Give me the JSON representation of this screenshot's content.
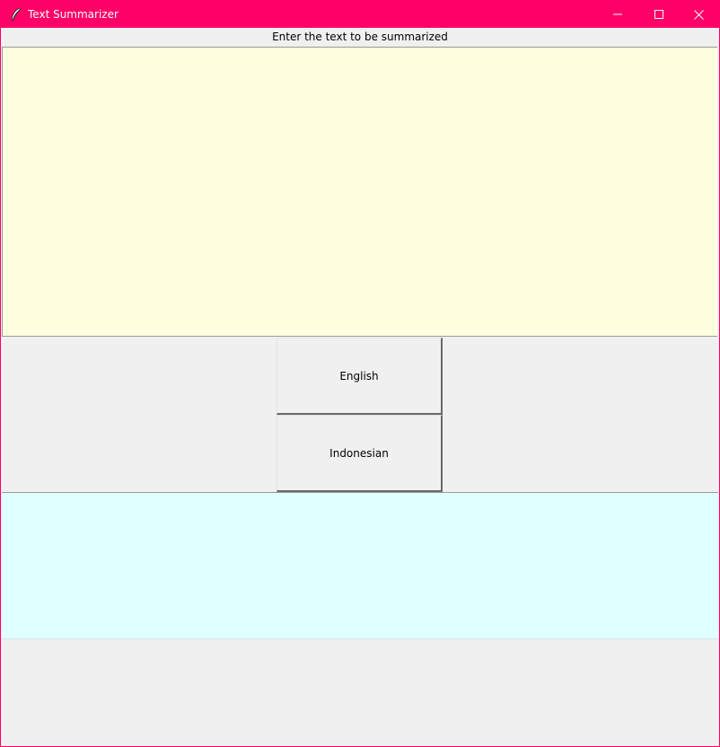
{
  "window": {
    "title": "Text Summarizer",
    "icon": "feather-icon",
    "accent_color": "#ff0068"
  },
  "prompt": {
    "label": "Enter the text to be summarized"
  },
  "input": {
    "value": "",
    "background": "#ffffe0"
  },
  "buttons": {
    "english_label": "English",
    "indonesian_label": "Indonesian"
  },
  "output": {
    "value": "",
    "background": "#e0ffff"
  }
}
